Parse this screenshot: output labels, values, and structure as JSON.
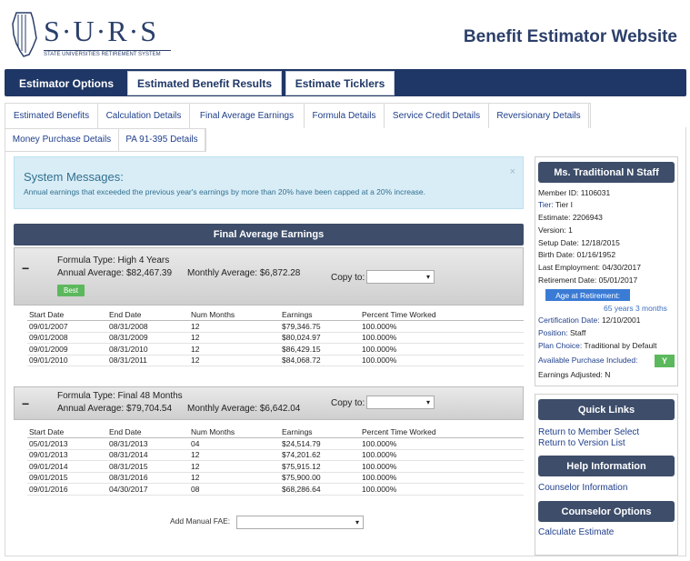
{
  "brand": {
    "logo_text": "S·U·R·S",
    "logo_sub": "STATE UNIVERSITIES RETIREMENT SYSTEM",
    "site_title": "Benefit Estimator Website"
  },
  "topnav": {
    "tabs": [
      {
        "label": "Estimator Options",
        "active": true
      },
      {
        "label": "Estimated Benefit Results",
        "active": false
      },
      {
        "label": "Estimate Ticklers",
        "active": false
      }
    ]
  },
  "subnav": {
    "row1": [
      "Estimated Benefits",
      "Calculation Details",
      "Final Average Earnings",
      "Formula Details",
      "Service Credit Details",
      "Reversionary Details"
    ],
    "row2": [
      "Money Purchase Details",
      "PA 91-395 Details"
    ]
  },
  "messages": {
    "title": "System Messages:",
    "text": "Annual earnings that exceeded the previous year's earnings by more than 20% have been capped at a 20% increase.",
    "close": "×"
  },
  "fae": {
    "header": "Final Average Earnings",
    "copy_to_label": "Copy to:",
    "columns": [
      "Start Date",
      "End Date",
      "Num Months",
      "Earnings",
      "Percent Time Worked"
    ],
    "formulas": [
      {
        "formula_type_label": "Formula Type:",
        "formula_type": "High 4 Years",
        "annual_label": "Annual Average:",
        "annual": "$82,467.39",
        "monthly_label": "Monthly Average:",
        "monthly": "$6,872.28",
        "badge": "Best",
        "rows": [
          [
            "09/01/2007",
            "08/31/2008",
            "12",
            "$79,346.75",
            "100.000%"
          ],
          [
            "09/01/2008",
            "08/31/2009",
            "12",
            "$80,024.97",
            "100.000%"
          ],
          [
            "09/01/2009",
            "08/31/2010",
            "12",
            "$86,429.15",
            "100.000%"
          ],
          [
            "09/01/2010",
            "08/31/2011",
            "12",
            "$84,068.72",
            "100.000%"
          ]
        ]
      },
      {
        "formula_type_label": "Formula Type:",
        "formula_type": "Final 48 Months",
        "annual_label": "Annual Average:",
        "annual": "$79,704.54",
        "monthly_label": "Monthly Average:",
        "monthly": "$6,642.04",
        "rows": [
          [
            "05/01/2013",
            "08/31/2013",
            "04",
            "$24,514.79",
            "100.000%"
          ],
          [
            "09/01/2013",
            "08/31/2014",
            "12",
            "$74,201.62",
            "100.000%"
          ],
          [
            "09/01/2014",
            "08/31/2015",
            "12",
            "$75,915.12",
            "100.000%"
          ],
          [
            "09/01/2015",
            "08/31/2016",
            "12",
            "$75,900.00",
            "100.000%"
          ],
          [
            "09/01/2016",
            "04/30/2017",
            "08",
            "$68,286.64",
            "100.000%"
          ]
        ]
      }
    ],
    "manual_label": "Add Manual FAE:"
  },
  "member": {
    "name": "Ms. Traditional N Staff",
    "member_id_label": "Member ID:",
    "member_id": "1106031",
    "tier_label": "Tier:",
    "tier": "Tier I",
    "estimate_label": "Estimate:",
    "estimate": "2206943",
    "version_label": "Version:",
    "version": "1",
    "setup_label": "Setup Date:",
    "setup": "12/18/2015",
    "birth_label": "Birth Date:",
    "birth": "01/16/1952",
    "last_emp_label": "Last Employment:",
    "last_emp": "04/30/2017",
    "retirement_label": "Retirement Date:",
    "retirement": "05/01/2017",
    "age_btn": "Age at Retirement:",
    "age_value": "65 years 3 months",
    "cert_label": "Certification Date:",
    "cert": "12/10/2001",
    "position_label": "Position:",
    "position": "Staff",
    "plan_label": "Plan Choice:",
    "plan": "Traditional by Default",
    "purchase_label": "Available Purchase Included:",
    "purchase": "Y",
    "adjusted_label": "Earnings Adjusted:",
    "adjusted": "N"
  },
  "quick_links": {
    "title": "Quick Links",
    "links": [
      "Return to Member Select",
      "Return to Version List"
    ]
  },
  "help": {
    "title": "Help Information",
    "links": [
      "Counselor Information"
    ]
  },
  "counselor": {
    "title": "Counselor Options",
    "links": [
      "Calculate Estimate"
    ]
  },
  "select_caret": "▾"
}
